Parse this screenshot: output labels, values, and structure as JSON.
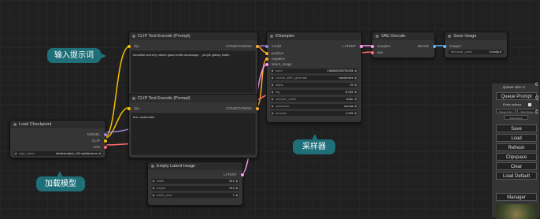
{
  "nodes": {
    "load_checkpoint": {
      "title": "Load Checkpoint",
      "outputs": [
        "MODEL",
        "CLIP",
        "VAE"
      ],
      "ckpt_label": "ckpt_name",
      "ckpt_value": "dreAnimated_v10.safetensors"
    },
    "clip_pos": {
      "title": "CLIP Text Encode (Prompt)",
      "input": "clip",
      "output": "CONDITIONING",
      "text": "beautiful scenery nature glass bottle landscape, , purple galaxy bottle,"
    },
    "clip_neg": {
      "title": "CLIP Text Encode (Prompt)",
      "input": "clip",
      "output": "CONDITIONING",
      "text": "text, watermark"
    },
    "ksampler": {
      "title": "KSampler",
      "inputs": [
        "model",
        "positive",
        "negative",
        "latent_image"
      ],
      "output": "LATENT",
      "widgets": [
        {
          "label": "seed",
          "value": "156680208700286"
        },
        {
          "label": "control_after_generate",
          "value": "randomize"
        },
        {
          "label": "steps",
          "value": "20"
        },
        {
          "label": "cfg",
          "value": "8.000"
        },
        {
          "label": "sampler_name",
          "value": "euler"
        },
        {
          "label": "scheduler",
          "value": "normal"
        },
        {
          "label": "denoise",
          "value": "1.000"
        }
      ]
    },
    "vae_decode": {
      "title": "VAE Decode",
      "inputs": [
        "samples",
        "vae"
      ],
      "output": "IMAGE"
    },
    "save_image": {
      "title": "Save Image",
      "input": "images",
      "prefix_label": "filename_prefix",
      "prefix_value": "ComfyUI"
    },
    "empty_latent": {
      "title": "Empty Latent Image",
      "output": "LATENT",
      "widgets": [
        {
          "label": "width",
          "value": "512"
        },
        {
          "label": "height",
          "value": "512"
        },
        {
          "label": "batch_size",
          "value": "1"
        }
      ]
    }
  },
  "callouts": {
    "prompt": "输入提示词",
    "sampler": "采样器",
    "model": "加载模型"
  },
  "menu": {
    "queue_size": "Queue size: 0",
    "queue_prompt": "Queue Prompt",
    "extra_options": "Extra options",
    "queue_front": "Queue Front",
    "view_queue": "View Queue",
    "view_history": "View History",
    "save": "Save",
    "load": "Load",
    "refresh": "Refresh",
    "clipspace": "Clipspace",
    "clear": "Clear",
    "load_default": "Load Default",
    "manager": "Manager",
    "cut_q": "Q",
    "cut_c": "C",
    "cut_6": "6"
  },
  "colors": {
    "clip_wire": "#f5c000",
    "model_wire": "#a080e0",
    "vae_wire": "#ff6f6f",
    "latent_wire": "#ff9cf9",
    "cond_wire": "#ffa931",
    "image_wire": "#64b5f6",
    "callout_bg": "#1f6f79"
  }
}
